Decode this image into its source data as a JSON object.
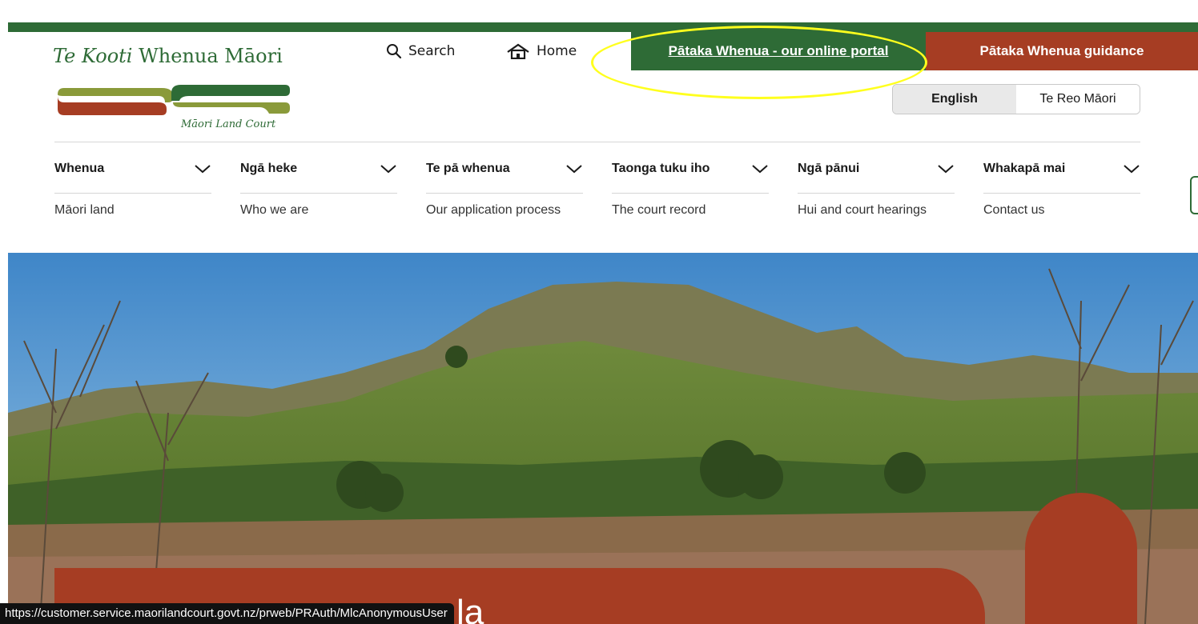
{
  "colors": {
    "brand_green": "#2e6b36",
    "brand_red": "#a63d23",
    "highlight": "#ffff1e"
  },
  "logo": {
    "title_italic": "Te Kooti",
    "title_rest": " Whenua Māori",
    "subtitle": "Māori Land Court"
  },
  "utility": {
    "search_icon": "search-icon",
    "search_label": "Search",
    "home_icon": "house-icon",
    "home_label": "Home"
  },
  "tabs": {
    "portal_label": "Pātaka Whenua - our online portal",
    "guidance_label": "Pātaka Whenua guidance"
  },
  "language": {
    "options": [
      "English",
      "Te Reo Māori"
    ],
    "selected": "English"
  },
  "nav": {
    "items": [
      {
        "label": "Whenua",
        "sub": "Māori land"
      },
      {
        "label": "Ngā heke",
        "sub": "Who we are"
      },
      {
        "label": "Te pā whenua",
        "sub": "Our application process"
      },
      {
        "label": "Taonga tuku iho",
        "sub": "The court record"
      },
      {
        "label": "Ngā pānui",
        "sub": "Hui and court hearings"
      },
      {
        "label": "Whakapā mai",
        "sub": "Contact us"
      }
    ]
  },
  "hero": {
    "partial_heading": "la"
  },
  "status_bar": {
    "url": "https://customer.service.maorilandcourt.govt.nz/prweb/PRAuth/MlcAnonymousUser"
  }
}
